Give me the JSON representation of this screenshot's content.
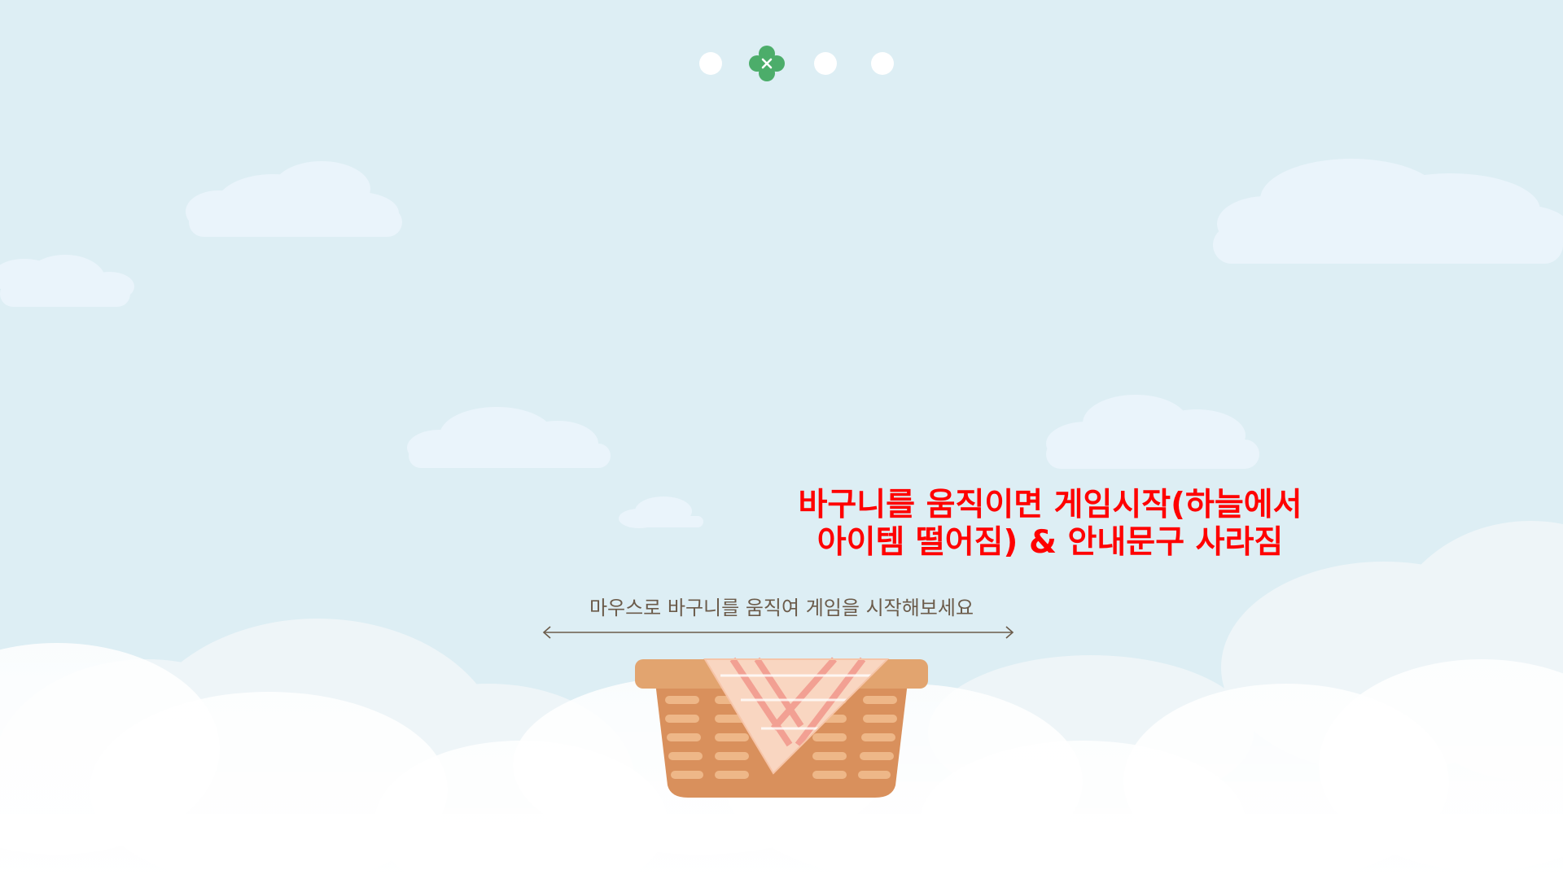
{
  "game": {
    "stage_total": 4,
    "stage_current": 2,
    "stage_current_icon": "clover-icon"
  },
  "annotation": {
    "line1": "바구니를 움직이면 게임시작(하늘에서",
    "line2": "아이템 떨어짐) & 안내문구 사라짐"
  },
  "instruction": {
    "text": "마우스로 바구니를 움직여 게임을 시작해보세요"
  },
  "colors": {
    "sky": "#ddeef4",
    "annotation": "#ff0000",
    "instruction": "#6b5b4a",
    "clover": "#4cad6a",
    "basket": "#d9905c",
    "basket_rim": "#e2a46f",
    "cloth_pink": "#f2a093"
  }
}
